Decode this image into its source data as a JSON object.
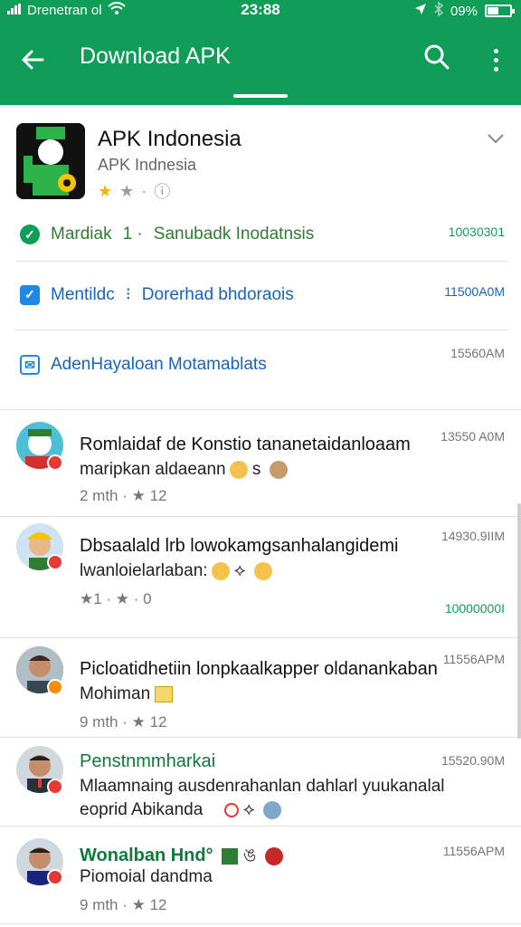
{
  "status_bar": {
    "carrier": "Drenetran ol",
    "time": "23:88",
    "battery": "09%"
  },
  "app_bar": {
    "title": "Download APK",
    "icons": [
      "back-arrow-icon",
      "search-icon",
      "more-vert-icon"
    ]
  },
  "app_info": {
    "name": "APK Indonesia",
    "publisher": "APK Indnesia",
    "rating_stars": 1,
    "rating_max": 2
  },
  "notices": [
    {
      "title": "Mardiak",
      "sep": "1 ·",
      "detail": "Sanubadk Inodatnsis",
      "time": "10030301",
      "color": "#0f9d58",
      "text_color": "#2e7d32",
      "icon": "check-circle-icon"
    },
    {
      "title": "Mentildc",
      "sep": "⁝",
      "detail": "Dorerhad bhdoraois",
      "time": "11500A0M",
      "color": "#1e88e5",
      "text_color": "#1565c0",
      "icon": "shield-icon"
    },
    {
      "title": "AdenHayaloan Motamablats",
      "sep": "",
      "detail": "",
      "time": "15560AM",
      "color": "#1e88e5",
      "text_color": "#1565c0",
      "icon": "envelope-icon"
    }
  ],
  "reviews": [
    {
      "title": "Romlaidaf de Konstio tananetaidanloaam",
      "body": "maripkan aldaeann",
      "meta": "2 mth · ★ 12",
      "time": "13550 A0M",
      "time2": ""
    },
    {
      "title": "Dbsaalald lrb lowokamgsanhalangidemi",
      "body": "lwanloielarlaban:",
      "meta": "★1 · ★ · 0",
      "time": "14930.9IIM",
      "time2": "10000000I"
    },
    {
      "title": "Picloatidhetiin lonpkaalkapper oldanankaban",
      "body": "Mohiman",
      "meta": "9 mth · ★ 12",
      "time": "11556APM",
      "time2": ""
    },
    {
      "title": "Penstnmmharkai",
      "body": "Mlaamnaing ausdenrahanlan dahlarl yuukanalal",
      "body3": "eoprid Abikanda",
      "meta": "",
      "time": "15520.90M",
      "time2": ""
    },
    {
      "title": "Wonalban Hnd°",
      "body": "Piomoial dandma",
      "meta": "9 mth · ★ 12",
      "time": "11556APM",
      "time2": ""
    }
  ]
}
